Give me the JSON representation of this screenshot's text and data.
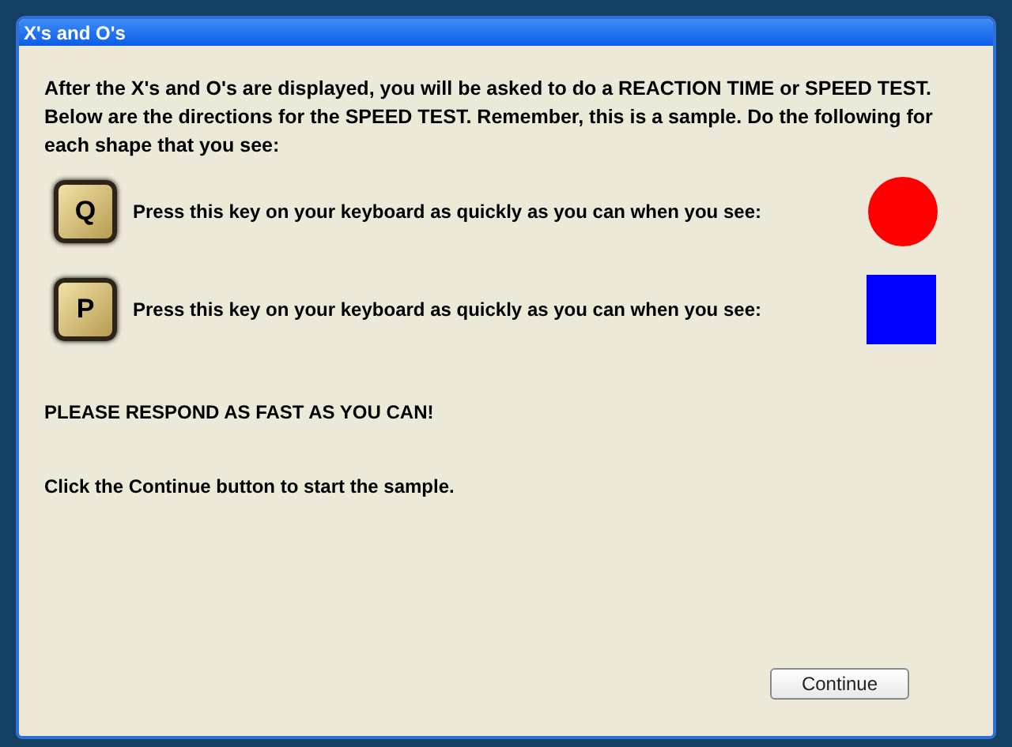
{
  "window": {
    "title": "X's and O's"
  },
  "intro": "After the X's and O's are displayed, you will be asked to do a REACTION TIME or SPEED TEST. Below are the directions for the SPEED TEST. Remember, this is a sample. Do the following for each shape that you see:",
  "rules": [
    {
      "key": "Q",
      "text": "Press this key on your keyboard as quickly as you can when you see:",
      "shape": {
        "kind": "circle",
        "color": "#ff0000"
      }
    },
    {
      "key": "P",
      "text": "Press this key on your keyboard as quickly as you can when you see:",
      "shape": {
        "kind": "square",
        "color": "#0000ff"
      }
    }
  ],
  "notice": "PLEASE RESPOND AS FAST AS YOU CAN!",
  "instruction": "Click the Continue button to start the sample.",
  "button": "Continue"
}
